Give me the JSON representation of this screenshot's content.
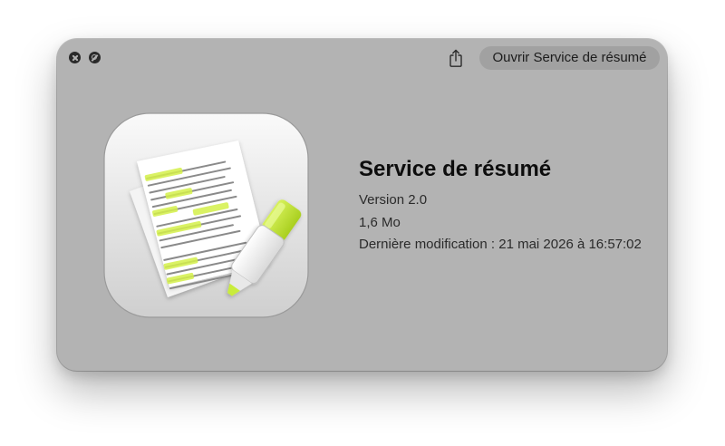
{
  "window": {
    "open_button_label": "Ouvrir Service de résumé"
  },
  "app": {
    "name": "Service de résumé",
    "version": "Version 2.0",
    "size": "1,6 Mo",
    "modified": "Dernière modification : 21 mai 2026 à 16:57:02"
  },
  "icons": {
    "close": "close-icon",
    "hide": "hide-icon",
    "share": "share-icon",
    "app": "summary-service-app-icon"
  },
  "colors": {
    "window_bg": "#b3b3b3",
    "button_bg": "#a1a1a1",
    "highlighter": "#c9ec3b"
  }
}
